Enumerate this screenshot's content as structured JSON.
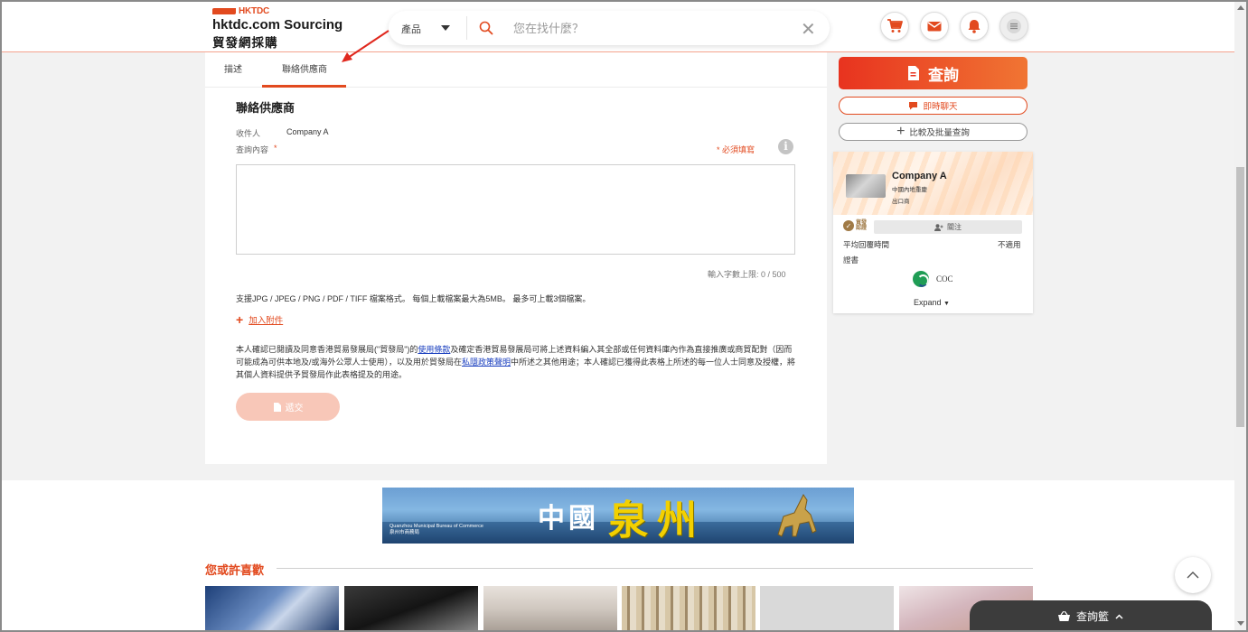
{
  "header": {
    "brand_small": "HKTDC",
    "brand_line1": "hktdc.com Sourcing",
    "brand_line2": "貿發網採購",
    "search_category": "產品",
    "search_placeholder": "您在找什麼？",
    "icons": [
      "cart-icon",
      "mail-icon",
      "bell-icon",
      "menu-icon"
    ]
  },
  "tabs": [
    {
      "label": "描述",
      "active": false
    },
    {
      "label": "聯絡供應商",
      "active": true
    }
  ],
  "form": {
    "title": "聯絡供應商",
    "recipient_label": "收件人",
    "recipient_value": "Company A",
    "content_label": "查詢內容",
    "required_star": "*",
    "required_note": "* 必須填寫",
    "content_value": "",
    "counter": "輸入字數上限: 0 / 500",
    "file_support": "支援JPG / JPEG / PNG / PDF / TIFF 檔案格式。 每個上載檔案最大為5MB。 最多可上載3個檔案。",
    "attach_label": "加入附件",
    "consent_part1": "本人確認已閱讀及同意香港貿易發展局(\"貿發局\")的",
    "consent_link1": "使用條款",
    "consent_part2": "及確定香港貿易發展局可將上述資料編入其全部或任何資料庫內作為直接推廣或商貿配對（因而可能成為可供本地及/或海外公眾人士使用），以及用於貿發局在",
    "consent_link2": "私隱政策聲明",
    "consent_part3": "中所述之其他用途；本人確認已獲得此表格上所述的每一位人士同意及授權，將其個人資料提供予貿發局作此表格提及的用途。",
    "submit_label": "遞交"
  },
  "sidebar": {
    "enquire_label": "查詢",
    "chat_label": "即時聊天",
    "compare_label": "比較及批量查詢",
    "supplier": {
      "name": "Company A",
      "location": "中國內地重慶",
      "type": "出口商",
      "verified_line1": "貿發",
      "verified_line2": "認證",
      "follow_label": "關注",
      "response_label": "平均回覆時間",
      "response_value": "不適用",
      "cert_label": "證書",
      "cert_name": "COC",
      "expand_label": "Expand"
    }
  },
  "banner": {
    "title_white": "中國",
    "title_yellow": "泉州",
    "bureau_en": "Quanzhou Municipal Bureau of Commerce",
    "bureau_cn": "泉州市商務局"
  },
  "recommend": {
    "title": "您或許喜歡"
  },
  "basket": {
    "label": "查詢籃"
  },
  "colors": {
    "accent": "#e24a1f",
    "link": "#1a3fbf",
    "submit_disabled": "#f8c7b8"
  }
}
